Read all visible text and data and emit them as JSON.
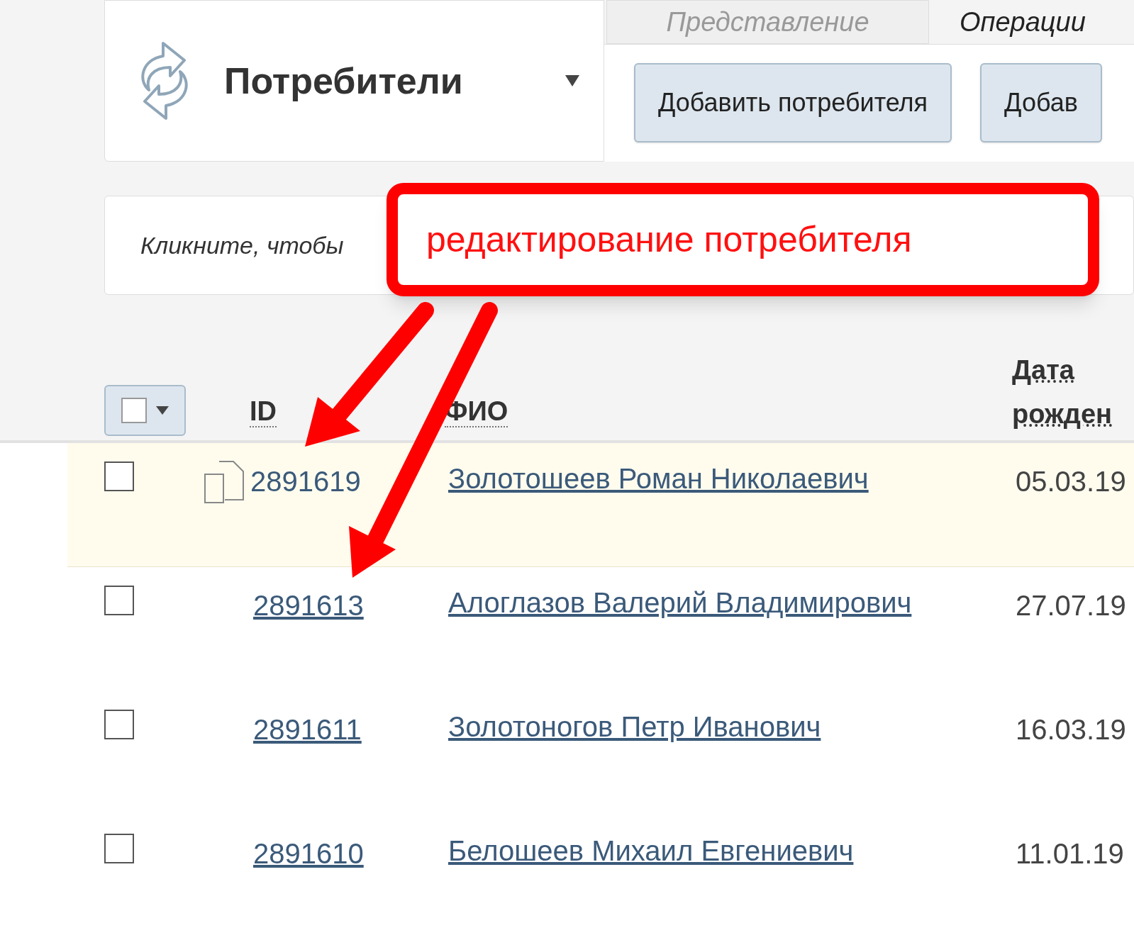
{
  "header": {
    "title": "Потребители",
    "tabs": [
      {
        "label": "Представление",
        "selected": false
      },
      {
        "label": "Операции",
        "selected": true
      }
    ],
    "buttons": [
      "Добавить потребителя",
      "Добав"
    ]
  },
  "search": {
    "placeholder": "Кликните, чтобы"
  },
  "callout": {
    "text": "редактирование потребителя"
  },
  "table": {
    "select_all": {
      "checked": false
    },
    "columns": [
      "ID",
      "ФИО",
      "Дата рожден"
    ],
    "rows": [
      {
        "checked": false,
        "selected": true,
        "id": "2891619",
        "name": "Золотошеев Роман Николаевич",
        "date": "05.03.19"
      },
      {
        "checked": false,
        "selected": false,
        "id": "2891613",
        "name": "Алоглазов Валерий Владимирович",
        "date": "27.07.19"
      },
      {
        "checked": false,
        "selected": false,
        "id": "2891611",
        "name": "Золотоногов Петр Иванович",
        "date": "16.03.19"
      },
      {
        "checked": false,
        "selected": false,
        "id": "2891610",
        "name": "Белошеев Михаил Евгениевич",
        "date": "11.01.19"
      }
    ]
  }
}
